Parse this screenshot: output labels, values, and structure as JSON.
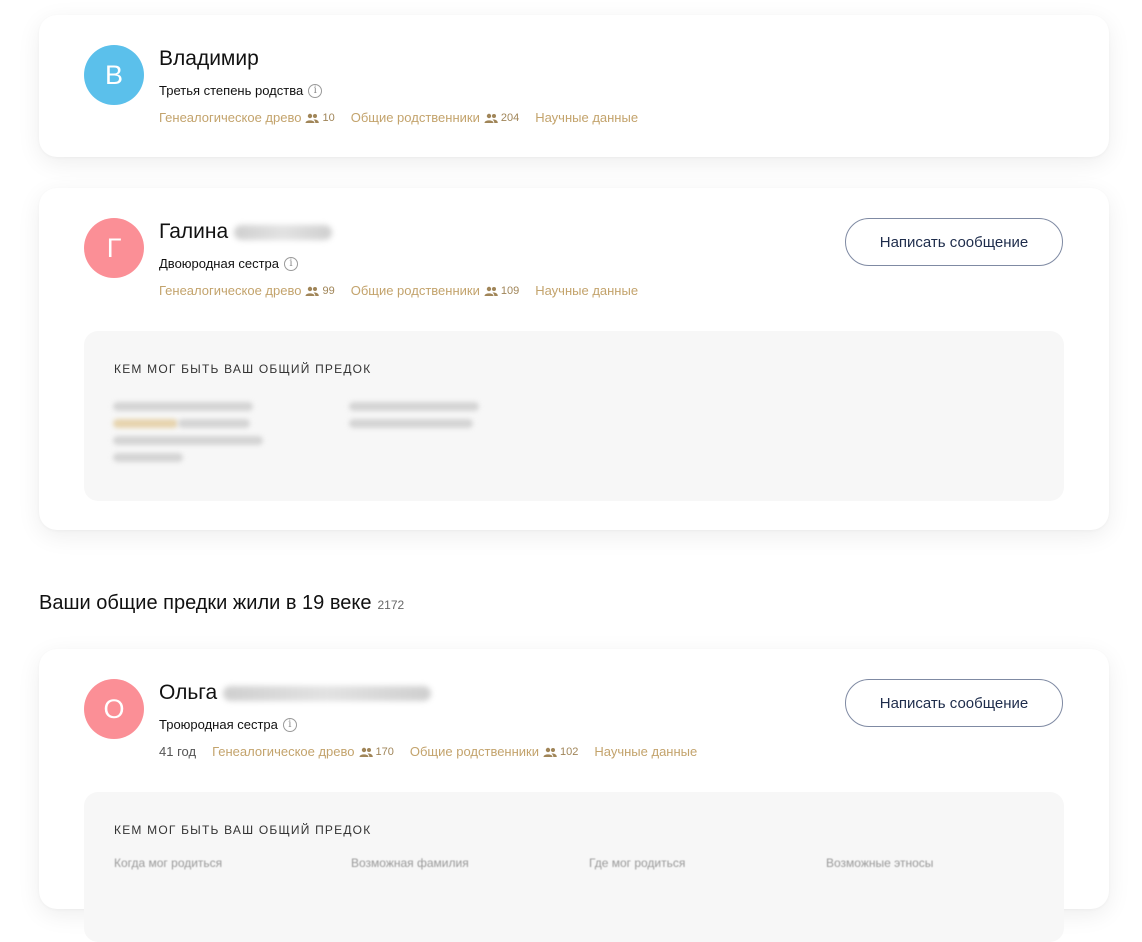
{
  "relatives": [
    {
      "initial": "В",
      "avatar_color": "#5bc0eb",
      "name": "Владимир",
      "relation": "Третья степень родства",
      "links": {
        "tree_label": "Генеалогическое древо",
        "tree_count": "10",
        "common_label": "Общие родственники",
        "common_count": "204",
        "science_label": "Научные данные"
      }
    },
    {
      "initial": "Г",
      "avatar_color": "#fb8f96",
      "name": "Галина",
      "relation": "Двоюродная сестра",
      "message_button": "Написать сообщение",
      "links": {
        "tree_label": "Генеалогическое древо",
        "tree_count": "99",
        "common_label": "Общие родственники",
        "common_count": "109",
        "science_label": "Научные данные"
      },
      "ancestor_title": "КЕМ МОГ БЫТЬ ВАШ ОБЩИЙ ПРЕДОК"
    },
    {
      "initial": "О",
      "avatar_color": "#fb8f96",
      "name": "Ольга",
      "relation": "Троюродная сестра",
      "age": "41 год",
      "message_button": "Написать сообщение",
      "links": {
        "tree_label": "Генеалогическое древо",
        "tree_count": "170",
        "common_label": "Общие родственники",
        "common_count": "102",
        "science_label": "Научные данные"
      },
      "ancestor_title": "КЕМ МОГ БЫТЬ ВАШ ОБЩИЙ ПРЕДОК",
      "ancestor_columns": [
        "Когда мог родиться",
        "Возможная фамилия",
        "Где мог родиться",
        "Возможные этносы"
      ]
    }
  ],
  "section": {
    "heading": "Ваши общие предки жили в 19 веке",
    "count": "2172"
  },
  "colors": {
    "accent_gold": "#c3a36c",
    "button_text": "#1e2c4b",
    "button_border": "#7f8aa3"
  }
}
